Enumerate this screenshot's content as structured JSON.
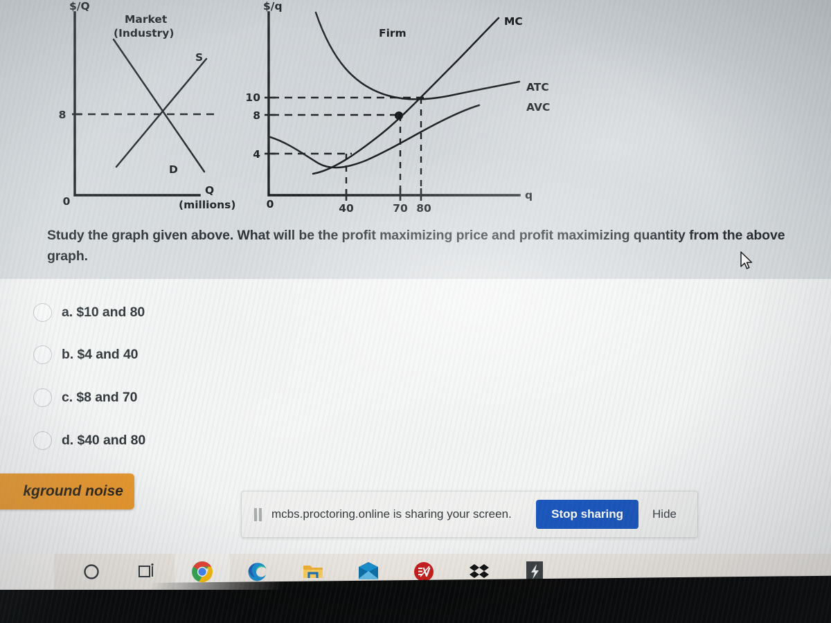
{
  "exam": {
    "question": {
      "line1": "Study the graph given above. What will be the profit maximizing price and profit maximizing quantity from the above",
      "line2": "graph."
    },
    "options": [
      {
        "id": "a",
        "label": "a. $10 and 80",
        "selected": false
      },
      {
        "id": "b",
        "label": "b. $4 and 40",
        "selected": false
      },
      {
        "id": "c",
        "label": "c. $8 and 70",
        "selected": false
      },
      {
        "id": "d",
        "label": "d. $40 and 80",
        "selected": false
      }
    ]
  },
  "chart_data": [
    {
      "type": "line",
      "title": "Market",
      "subtitle": "(Industry)",
      "xlabel": "Q",
      "xlabel_sub": "(millions)",
      "ylabel": "$/Q",
      "origin_label": "0",
      "ytick_labels": [
        "8"
      ],
      "series": [
        {
          "name": "S",
          "note": "upward sloping supply curve"
        },
        {
          "name": "D",
          "note": "downward sloping demand curve"
        }
      ],
      "annotations": [
        {
          "text": "equilibrium price dashed line at 8",
          "value": 8
        }
      ],
      "grid": false,
      "legend": "inline-curve-labels"
    },
    {
      "type": "line",
      "title": "Firm",
      "xlabel": "q",
      "ylabel": "$/q",
      "origin_label": "0",
      "ytick_labels": [
        "10",
        "8",
        "4"
      ],
      "ytick_values": [
        10,
        8,
        4
      ],
      "xtick_labels": [
        "40",
        "70",
        "80"
      ],
      "xtick_values": [
        40,
        70,
        80
      ],
      "series": [
        {
          "name": "MC",
          "note": "marginal cost, upward sloping, cuts ATC at minimum"
        },
        {
          "name": "ATC",
          "note": "average total cost, U-shaped, minimum near 10 at q=80"
        },
        {
          "name": "AVC",
          "note": "average variable cost, U-shaped, minimum 4 near q=40"
        }
      ],
      "annotations": [
        {
          "text": "dashed line at price 10 to ATC minimum",
          "value": 10
        },
        {
          "text": "dashed line at price 8 to MC point",
          "value": 8
        },
        {
          "text": "dashed line at 4 to AVC minimum",
          "value": 4
        },
        {
          "text": "dot marking MC at price 8, q=70"
        },
        {
          "text": "vertical dashed line at q=40"
        },
        {
          "text": "vertical dashed line at q=70"
        },
        {
          "text": "vertical dashed line at q=80"
        }
      ],
      "grid": false,
      "legend": "inline-curve-labels"
    }
  ],
  "overlays": {
    "noise_badge": {
      "text": "kground noise",
      "color": "#e8962a"
    }
  },
  "share_bar": {
    "pause_icon": "pause-icon",
    "message": "mcbs.proctoring.online is sharing your screen.",
    "stop_label": "Stop sharing",
    "hide_label": "Hide",
    "accent": "#1a56bd"
  },
  "taskbar": {
    "items": [
      {
        "name": "cortana-icon",
        "label": "Cortana",
        "active": false
      },
      {
        "name": "task-view-icon",
        "label": "Task View",
        "active": false
      },
      {
        "name": "chrome-icon",
        "label": "Google Chrome",
        "active": true
      },
      {
        "name": "edge-icon",
        "label": "Microsoft Edge",
        "active": false
      },
      {
        "name": "file-explorer-icon",
        "label": "File Explorer",
        "active": false
      },
      {
        "name": "mail-icon",
        "label": "Mail",
        "active": false
      },
      {
        "name": "expressvpn-icon",
        "label": "ExpressVPN",
        "active": false
      },
      {
        "name": "dropbox-icon",
        "label": "Dropbox",
        "active": false
      },
      {
        "name": "app-icon",
        "label": "App",
        "active": false
      }
    ]
  }
}
